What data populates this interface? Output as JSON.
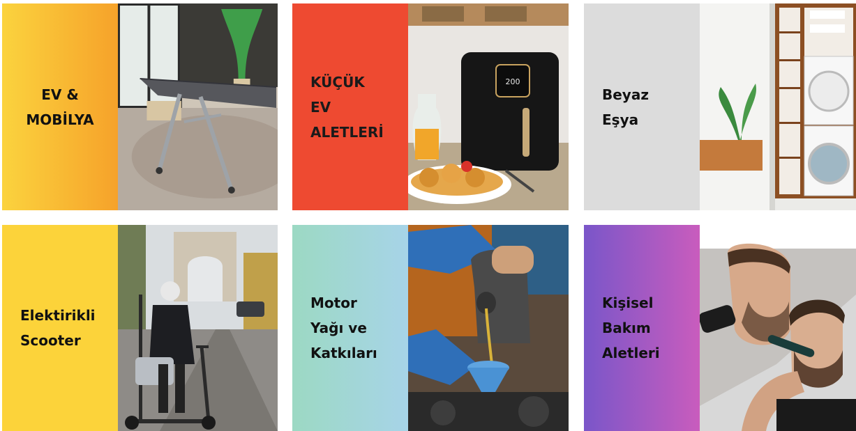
{
  "categories": [
    {
      "label": "EV  &\nMOBİLYA",
      "image": "ironing-board-photo"
    },
    {
      "label": "KÜÇÜK\nEV\nALETLERİ",
      "image": "air-fryer-photo"
    },
    {
      "label": "Beyaz\nEşya",
      "image": "washing-machine-photo"
    },
    {
      "label": "Elektirikli\nScooter",
      "image": "electric-scooter-photo"
    },
    {
      "label": "Motor\nYağı ve\nKatkıları",
      "image": "motor-oil-photo"
    },
    {
      "label": "Kişisel\nBakım\nAletleri",
      "image": "trimmer-photo"
    }
  ],
  "air_fryer_display": "200",
  "colors": {
    "home_furniture": "#f6a22a",
    "small_appliances": "#ee4a31",
    "white_goods": "#dcdcdc",
    "scooter": "#fcd33a",
    "motor_oil": "#a7d4e8",
    "personal_care": "#9b58c4"
  }
}
